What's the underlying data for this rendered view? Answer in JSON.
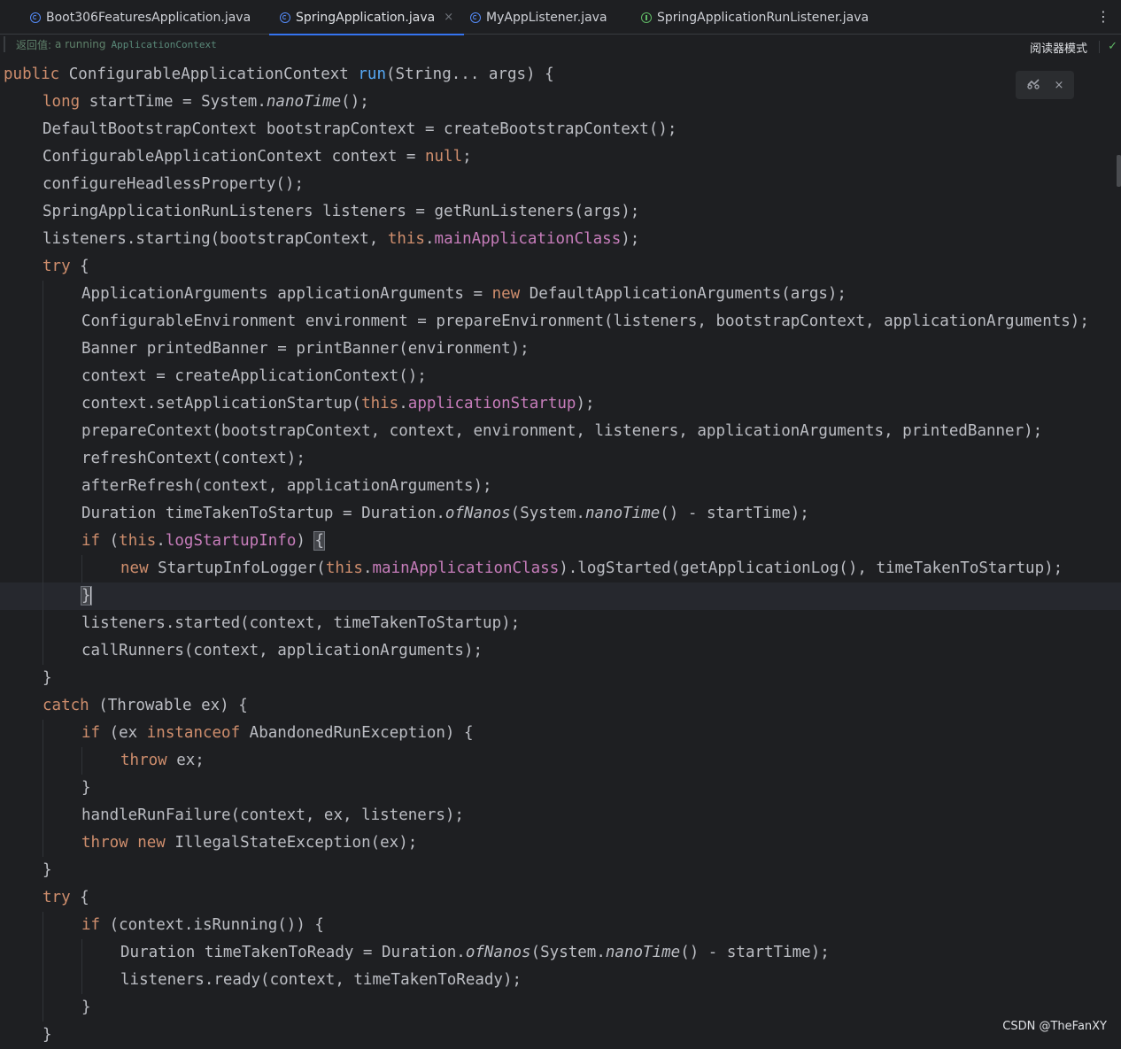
{
  "tabs": [
    {
      "label": "Boot306FeaturesApplication.java",
      "icon": "spring-class-icon",
      "active": false
    },
    {
      "label": "SpringApplication.java",
      "icon": "class-icon",
      "active": true,
      "close": "×"
    },
    {
      "label": "MyAppListener.java",
      "icon": "class-icon",
      "active": false
    },
    {
      "label": "SpringApplicationRunListener.java",
      "icon": "interface-icon",
      "active": false
    }
  ],
  "more_menu": "⋮",
  "hint": {
    "label": "返回值:",
    "text": "a running",
    "code": "ApplicationContext"
  },
  "reader_mode": "阅读器模式",
  "float_close": "×",
  "watermark": "CSDN @TheFanXY",
  "code_lines": [
    {
      "i": 0,
      "s": [
        [
          "kw",
          "public "
        ],
        [
          "",
          "ConfigurableApplicationContext "
        ],
        [
          "fn",
          "run"
        ],
        [
          "",
          "(String... args) {"
        ]
      ]
    },
    {
      "i": 1,
      "s": [
        [
          "kw",
          "long "
        ],
        [
          "",
          "startTime = System."
        ],
        [
          "it",
          "nanoTime"
        ],
        [
          "",
          "();"
        ]
      ]
    },
    {
      "i": 1,
      "s": [
        [
          "",
          "DefaultBootstrapContext bootstrapContext = createBootstrapContext();"
        ]
      ]
    },
    {
      "i": 1,
      "s": [
        [
          "",
          "ConfigurableApplicationContext context = "
        ],
        [
          "kw",
          "null"
        ],
        [
          "",
          ";"
        ]
      ]
    },
    {
      "i": 1,
      "s": [
        [
          "",
          "configureHeadlessProperty();"
        ]
      ]
    },
    {
      "i": 1,
      "s": [
        [
          "",
          "SpringApplicationRunListeners listeners = getRunListeners(args);"
        ]
      ]
    },
    {
      "i": 1,
      "s": [
        [
          "",
          "listeners.starting(bootstrapContext, "
        ],
        [
          "kw",
          "this"
        ],
        [
          "",
          "."
        ],
        [
          "fld",
          "mainApplicationClass"
        ],
        [
          "",
          ");"
        ]
      ]
    },
    {
      "i": 1,
      "s": [
        [
          "kw",
          "try "
        ],
        [
          "",
          "{"
        ]
      ]
    },
    {
      "i": 2,
      "s": [
        [
          "",
          "ApplicationArguments applicationArguments = "
        ],
        [
          "kw",
          "new "
        ],
        [
          "",
          "DefaultApplicationArguments(args);"
        ]
      ]
    },
    {
      "i": 2,
      "s": [
        [
          "",
          "ConfigurableEnvironment environment = prepareEnvironment(listeners, bootstrapContext, applicationArguments);"
        ]
      ]
    },
    {
      "i": 2,
      "s": [
        [
          "",
          "Banner printedBanner = printBanner(environment);"
        ]
      ]
    },
    {
      "i": 2,
      "s": [
        [
          "",
          "context = createApplicationContext();"
        ]
      ]
    },
    {
      "i": 2,
      "s": [
        [
          "",
          "context.setApplicationStartup("
        ],
        [
          "kw",
          "this"
        ],
        [
          "",
          "."
        ],
        [
          "fld",
          "applicationStartup"
        ],
        [
          "",
          ");"
        ]
      ]
    },
    {
      "i": 2,
      "s": [
        [
          "",
          "prepareContext(bootstrapContext, context, environment, listeners, applicationArguments, printedBanner);"
        ]
      ]
    },
    {
      "i": 2,
      "s": [
        [
          "",
          "refreshContext(context);"
        ]
      ]
    },
    {
      "i": 2,
      "s": [
        [
          "",
          "afterRefresh(context, applicationArguments);"
        ]
      ]
    },
    {
      "i": 2,
      "s": [
        [
          "",
          "Duration timeTakenToStartup = Duration."
        ],
        [
          "it",
          "ofNanos"
        ],
        [
          "",
          "(System."
        ],
        [
          "it",
          "nanoTime"
        ],
        [
          "",
          "() - startTime);"
        ]
      ]
    },
    {
      "i": 2,
      "s": [
        [
          "kw",
          "if "
        ],
        [
          "",
          "("
        ],
        [
          "kw",
          "this"
        ],
        [
          "",
          "."
        ],
        [
          "fld",
          "logStartupInfo"
        ],
        [
          "",
          ") "
        ],
        [
          "brk",
          "{"
        ]
      ]
    },
    {
      "i": 3,
      "s": [
        [
          "kw",
          "new "
        ],
        [
          "",
          "StartupInfoLogger("
        ],
        [
          "kw",
          "this"
        ],
        [
          "",
          "."
        ],
        [
          "fld",
          "mainApplicationClass"
        ],
        [
          "",
          ").logStarted(getApplicationLog(), timeTakenToStartup);"
        ]
      ]
    },
    {
      "i": 2,
      "current": true,
      "s": [
        [
          "brk",
          "}"
        ],
        [
          "caret",
          ""
        ]
      ]
    },
    {
      "i": 2,
      "s": [
        [
          "",
          "listeners.started(context, timeTakenToStartup);"
        ]
      ]
    },
    {
      "i": 2,
      "s": [
        [
          "",
          "callRunners(context, applicationArguments);"
        ]
      ]
    },
    {
      "i": 1,
      "s": [
        [
          "",
          "}"
        ]
      ]
    },
    {
      "i": 1,
      "s": [
        [
          "kw",
          "catch "
        ],
        [
          "",
          "(Throwable ex) {"
        ]
      ]
    },
    {
      "i": 2,
      "s": [
        [
          "kw",
          "if "
        ],
        [
          "",
          "(ex "
        ],
        [
          "kw",
          "instanceof "
        ],
        [
          "",
          "AbandonedRunException) {"
        ]
      ]
    },
    {
      "i": 3,
      "s": [
        [
          "kw",
          "throw "
        ],
        [
          "",
          "ex;"
        ]
      ]
    },
    {
      "i": 2,
      "s": [
        [
          "",
          "}"
        ]
      ]
    },
    {
      "i": 2,
      "s": [
        [
          "",
          "handleRunFailure(context, ex, listeners);"
        ]
      ]
    },
    {
      "i": 2,
      "s": [
        [
          "kw",
          "throw new "
        ],
        [
          "",
          "IllegalStateException(ex);"
        ]
      ]
    },
    {
      "i": 1,
      "s": [
        [
          "",
          "}"
        ]
      ]
    },
    {
      "i": 1,
      "s": [
        [
          "kw",
          "try "
        ],
        [
          "",
          "{"
        ]
      ]
    },
    {
      "i": 2,
      "s": [
        [
          "kw",
          "if "
        ],
        [
          "",
          "(context.isRunning()) {"
        ]
      ]
    },
    {
      "i": 3,
      "s": [
        [
          "",
          "Duration timeTakenToReady = Duration."
        ],
        [
          "it",
          "ofNanos"
        ],
        [
          "",
          "(System."
        ],
        [
          "it",
          "nanoTime"
        ],
        [
          "",
          "() - startTime);"
        ]
      ]
    },
    {
      "i": 3,
      "s": [
        [
          "",
          "listeners.ready(context, timeTakenToReady);"
        ]
      ]
    },
    {
      "i": 2,
      "s": [
        [
          "",
          "}"
        ]
      ]
    },
    {
      "i": 1,
      "s": [
        [
          "",
          "}"
        ]
      ]
    }
  ]
}
